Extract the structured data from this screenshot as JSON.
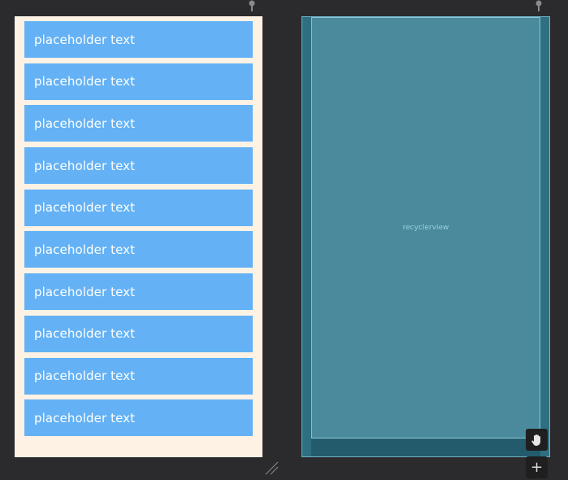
{
  "design_view": {
    "items": [
      {
        "label": "placeholder text"
      },
      {
        "label": "placeholder text"
      },
      {
        "label": "placeholder text"
      },
      {
        "label": "placeholder text"
      },
      {
        "label": "placeholder text"
      },
      {
        "label": "placeholder text"
      },
      {
        "label": "placeholder text"
      },
      {
        "label": "placeholder text"
      },
      {
        "label": "placeholder text"
      },
      {
        "label": "placeholder text"
      }
    ]
  },
  "blueprint_view": {
    "widget_label": "recyclerview"
  },
  "toolbar": {
    "pan_icon": "hand-pan-icon",
    "add_icon": "plus-icon",
    "add_label": "+"
  },
  "colors": {
    "background": "#2b2b2d",
    "design_surface": "#fdf2e4",
    "list_item": "#64b2f5",
    "blueprint_surface": "#245b6c",
    "blueprint_widget": "#4b8a9d"
  }
}
